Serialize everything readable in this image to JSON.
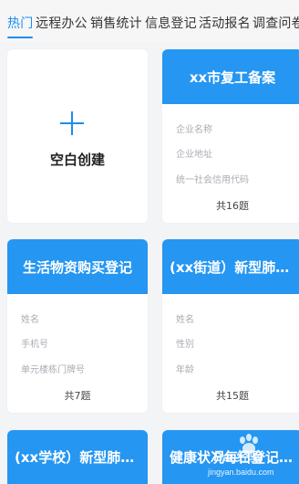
{
  "tabs": [
    {
      "label": "热门"
    },
    {
      "label": "远程办公"
    },
    {
      "label": "销售统计"
    },
    {
      "label": "信息登记"
    },
    {
      "label": "活动报名"
    },
    {
      "label": "调查问卷"
    }
  ],
  "colors": {
    "accent": "#1d8cf0",
    "header": "#2596f2"
  },
  "blank_card": {
    "label": "空白创建",
    "icon": "plus-icon"
  },
  "cards": [
    {
      "title": "xx市复工备案",
      "fields": [
        "企业名称",
        "企业地址",
        "统一社会信用代码"
      ],
      "count": "共16题"
    },
    {
      "title": "生活物资购买登记",
      "fields": [
        "姓名",
        "手机号",
        "单元楼栋门牌号"
      ],
      "count": "共7题"
    },
    {
      "title": "(xx街道）新型肺炎...",
      "fields": [
        "姓名",
        "性别",
        "年龄"
      ],
      "count": "共15题"
    },
    {
      "title": "(xx学校）新型肺炎...",
      "fields": [],
      "count": ""
    },
    {
      "title": "健康状况每日登记（...",
      "fields": [],
      "count": ""
    }
  ],
  "watermark": {
    "text": "Bai 经验",
    "url": "jingyan.baidu.com"
  }
}
